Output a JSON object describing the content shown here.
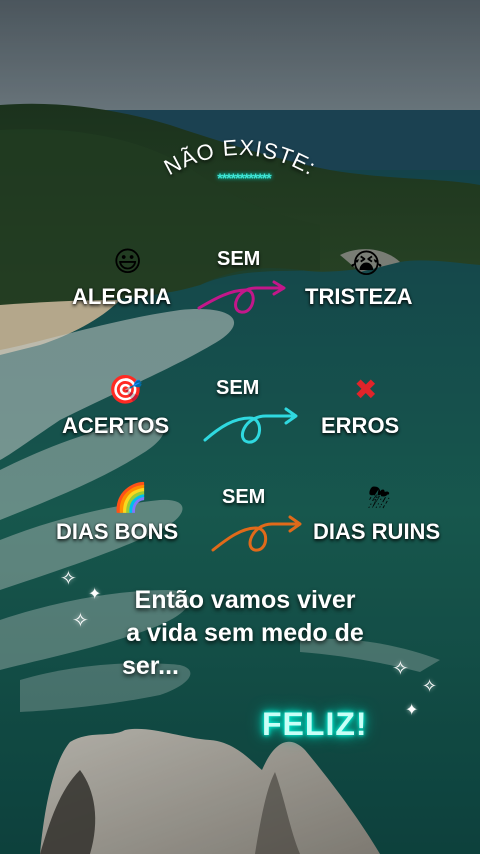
{
  "header": {
    "title": "NÃO EXISTE:",
    "stars": "************"
  },
  "pairs": [
    {
      "left": "ALEGRIA",
      "left_icon": "grinning-face-icon",
      "connector": "SEM",
      "right": "TRISTEZA",
      "right_icon": "crying-face-icon",
      "arrow_color": "#c3178a"
    },
    {
      "left": "ACERTOS",
      "left_icon": "direct-hit-target-icon",
      "connector": "SEM",
      "right": "ERROS",
      "right_icon": "cross-mark-icon",
      "arrow_color": "#2fd9e0"
    },
    {
      "left": "DIAS BONS",
      "left_icon": "rainbow-icon",
      "connector": "SEM",
      "right": "DIAS RUINS",
      "right_icon": "storm-cloud-icon",
      "arrow_color": "#e06a1a"
    }
  ],
  "closing": {
    "line1": "Então vamos viver",
    "line2": "a vida sem medo de",
    "line3": "ser..."
  },
  "highlight": "FELIZ!",
  "colors": {
    "accent_teal": "#3fe6d7",
    "text": "#ffffff"
  }
}
